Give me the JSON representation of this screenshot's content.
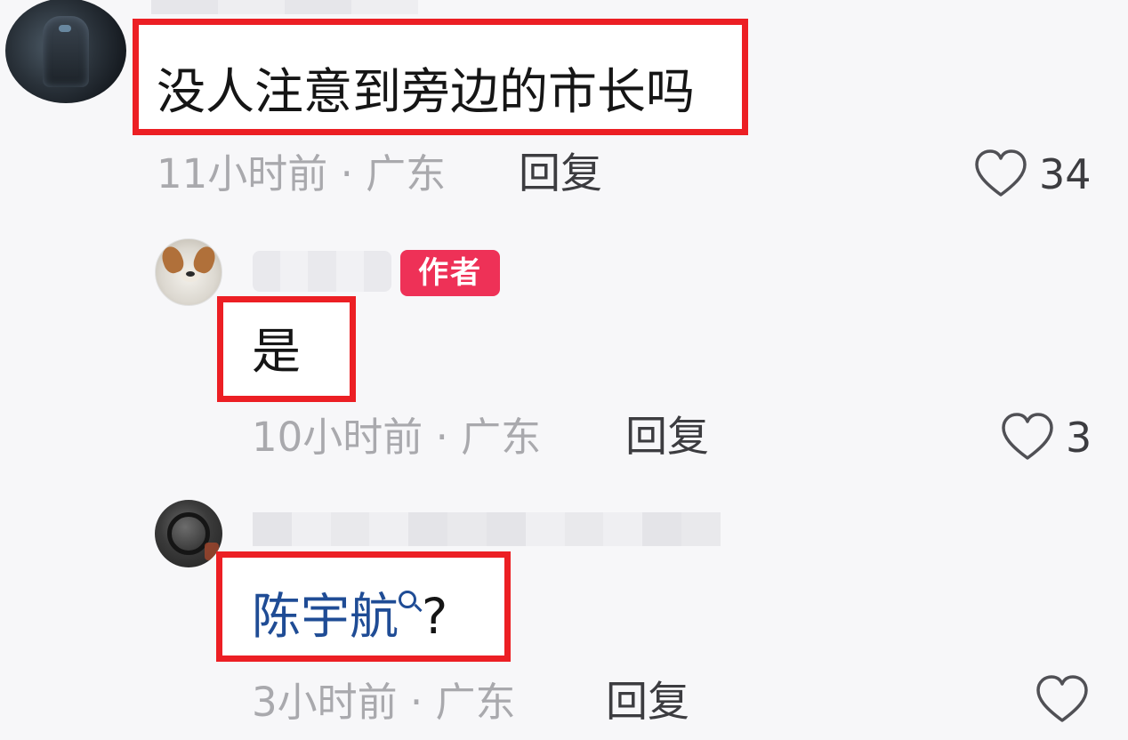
{
  "comments": [
    {
      "text": "没人注意到旁边的市长吗",
      "meta": "11小时前 · 广东",
      "reply_label": "回复",
      "likes": "34"
    },
    {
      "badge": "作者",
      "text": "是",
      "meta": "10小时前 · 广东",
      "reply_label": "回复",
      "likes": "3"
    },
    {
      "link_text": "陈宇航",
      "suffix": "?",
      "meta": "3小时前 · 广东",
      "reply_label": "回复"
    }
  ],
  "colors": {
    "highlight_border": "#ec1f24",
    "author_badge": "#ee3157",
    "link": "#1f4c95",
    "meta_text": "#a9a9ad"
  },
  "icons": {
    "like": "heart-outline-icon",
    "search": "search-icon"
  }
}
